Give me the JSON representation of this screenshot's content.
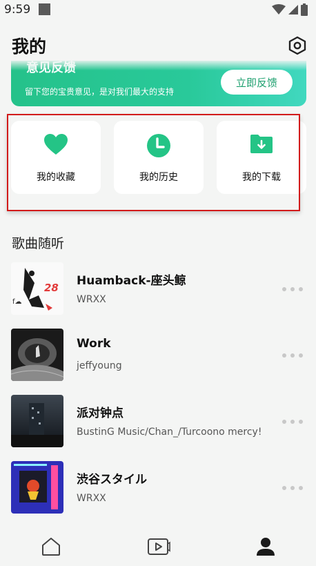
{
  "status_bar": {
    "time": "9:59"
  },
  "header": {
    "title": "我的"
  },
  "banner": {
    "title": "意见反馈",
    "subtitle": "留下您的宝贵意见，是对我们最大的支持",
    "button_label": "立即反馈"
  },
  "quick_cards": [
    {
      "label": "我的收藏",
      "icon": "heart-icon"
    },
    {
      "label": "我的历史",
      "icon": "clock-icon"
    },
    {
      "label": "我的下载",
      "icon": "folder-download-icon"
    }
  ],
  "section": {
    "title": "歌曲随听"
  },
  "songs": [
    {
      "title": "Huamback-座头鲸",
      "artist": "WRXX"
    },
    {
      "title": "Work",
      "artist": "jeffyoung"
    },
    {
      "title": "派对钟点",
      "artist": "BustinG Music/Chan_/Turcoono mercy!"
    },
    {
      "title": "渋谷スタイル",
      "artist": "WRXX"
    }
  ],
  "bottom_nav": [
    {
      "icon": "home-icon",
      "selected": false
    },
    {
      "icon": "video-icon",
      "selected": false
    },
    {
      "icon": "profile-icon",
      "selected": true
    }
  ],
  "colors": {
    "accent": "#24c486",
    "highlight_box": "#d21a1a",
    "background": "#f4f5f4"
  }
}
